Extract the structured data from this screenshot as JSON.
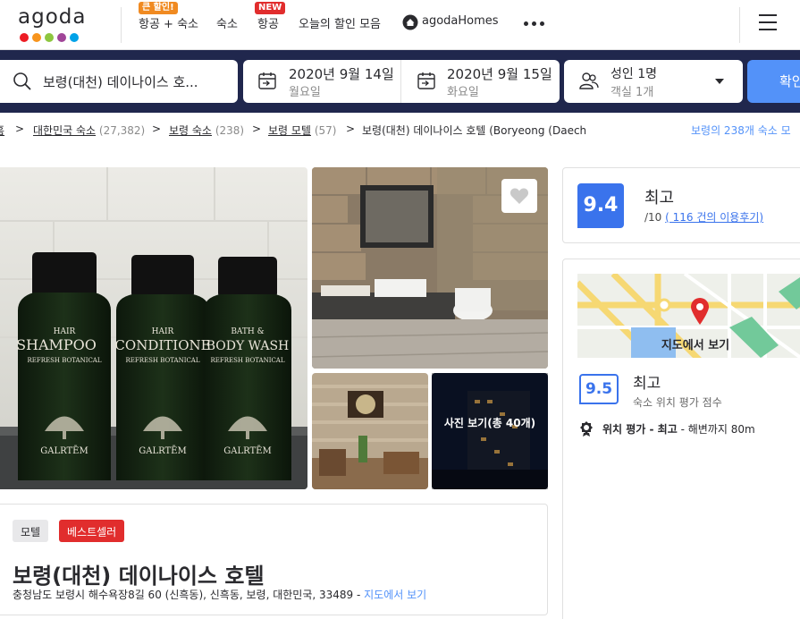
{
  "brand": {
    "logo_text": "agoda",
    "dot_colors": [
      "#ed1c24",
      "#f7941d",
      "#8dc63f",
      "#a04598",
      "#00a2e8"
    ]
  },
  "nav": {
    "flight_hotel": "항공 + 숙소",
    "flight_hotel_badge": "큰 할인!",
    "hotel": "숙소",
    "flight": "항공",
    "flight_badge": "NEW",
    "deals": "오늘의 할인 모음",
    "homes": "agodaHomes"
  },
  "search": {
    "destination": "보령(대천) 데이나이스 호...",
    "checkin_date": "2020년 9월 14일",
    "checkin_day": "월요일",
    "checkout_date": "2020년 9월 15일",
    "checkout_day": "화요일",
    "guests": "성인 1명",
    "rooms": "객실 1개",
    "confirm_label": "확인"
  },
  "breadcrumb": {
    "home": "홈",
    "country": "대한민국 숙소",
    "country_count": "(27,382)",
    "city": "보령 숙소",
    "city_count": "(238)",
    "type": "보령 모텔",
    "type_count": "(57)",
    "current": "보령(대천) 데이나이스 호텔 (Boryeong (Daech",
    "right_link": "보령의 238개 숙소 모"
  },
  "gallery": {
    "more_photos": "사진 보기(총 40개)",
    "bottle1_top": "HAIR",
    "bottle1_name": "SHAMPOO",
    "bottle2_top": "HAIR",
    "bottle2_name": "CONDITIONE",
    "bottle3_top": "BATH &",
    "bottle3_name": "BODY WASH",
    "bottle_sub": "REFRESH BOTANICAL",
    "bottle_brand": "GALRTĒM"
  },
  "hotel": {
    "tag_type": "모텔",
    "tag_best": "베스트셀러",
    "name": "보령(대천) 데이나이스 호텔",
    "address": "충청남도 보령시 해수욕장8길 60 (신흑동), 신흑동, 보령, 대한민국, 33489 - ",
    "map_link": "지도에서 보기"
  },
  "rating": {
    "score": "9.4",
    "label": "최고",
    "out_of": "/10 ",
    "reviews_link": "( 116 건의 이용후기)"
  },
  "location": {
    "map_label": "지도에서 보기",
    "score": "9.5",
    "label": "최고",
    "sub": "숙소 위치 평가 점수",
    "rating_text": "위치 평가 - 최고",
    "distance": " - 해변까지 80m"
  },
  "colors": {
    "nav_dark": "#20274d",
    "accent_blue": "#5392f9",
    "score_blue": "#3a73ec",
    "best_red": "#e12d2d",
    "badge_orange": "#f08a21",
    "badge_red": "#e12d2d"
  }
}
